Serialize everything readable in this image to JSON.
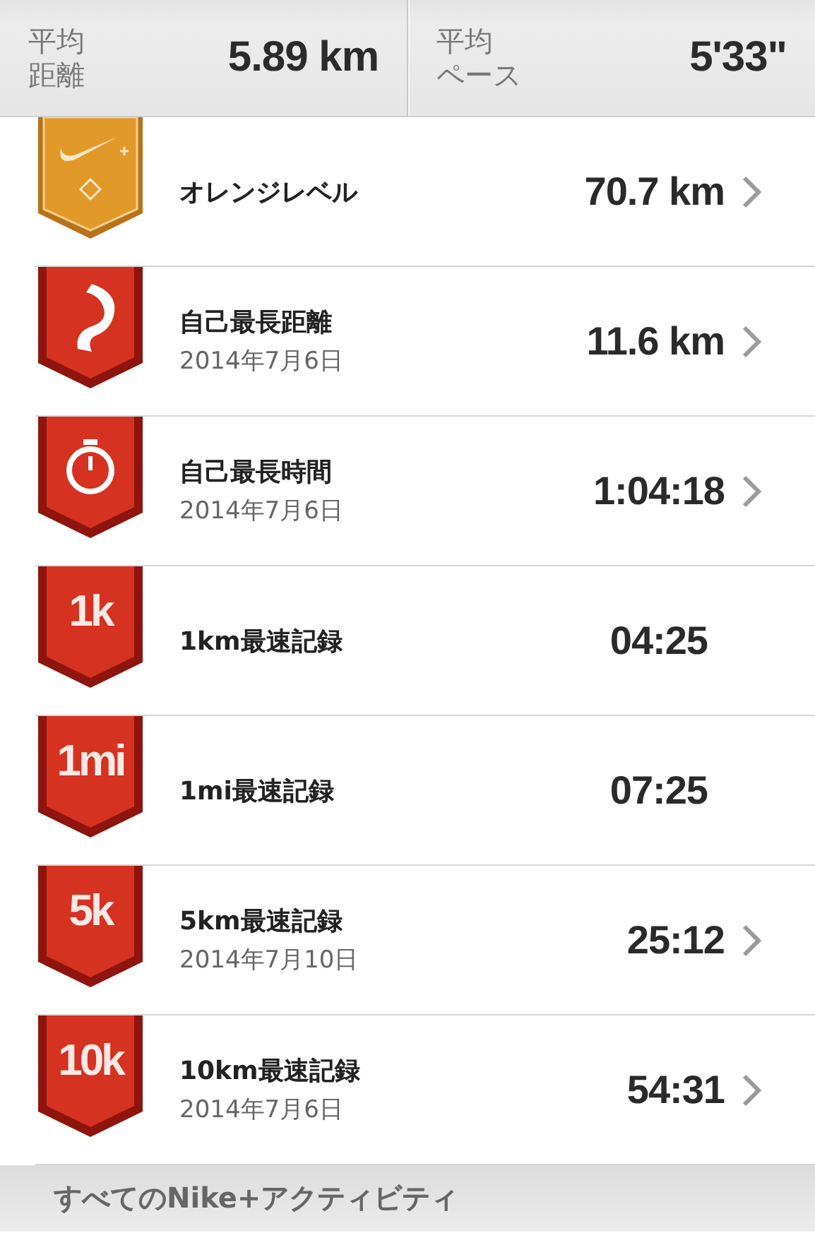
{
  "summary": [
    {
      "label": [
        "平均",
        "距離"
      ],
      "value": "5.89 km"
    },
    {
      "label": [
        "平均",
        "ペース"
      ],
      "value": "5'33\""
    }
  ],
  "records": [
    {
      "badge": {
        "kind": "level"
      },
      "title": "オレンジレベル",
      "value": "70.7 km",
      "has_detail": true
    },
    {
      "badge": {
        "kind": "distance"
      },
      "title": "自己最長距離",
      "date": "2014年7月6日",
      "value": "11.6 km",
      "has_detail": true
    },
    {
      "badge": {
        "kind": "time"
      },
      "title": "自己最長時間",
      "date": "2014年7月6日",
      "value": "1:04:18",
      "has_detail": true
    },
    {
      "badge": {
        "kind": "text",
        "text": "1k"
      },
      "title": "1km最速記録",
      "value": "04:25",
      "has_detail": false
    },
    {
      "badge": {
        "kind": "text",
        "text": "1mi"
      },
      "title": "1mi最速記録",
      "value": "07:25",
      "has_detail": false
    },
    {
      "badge": {
        "kind": "text",
        "text": "5k"
      },
      "title": "5km最速記録",
      "date": "2014年7月10日",
      "value": "25:12",
      "has_detail": true
    },
    {
      "badge": {
        "kind": "text",
        "text": "10k"
      },
      "title": "10km最速記録",
      "date": "2014年7月6日",
      "value": "54:31",
      "has_detail": true
    }
  ],
  "footer": {
    "label": "すべてのNike+アクティビティ"
  }
}
